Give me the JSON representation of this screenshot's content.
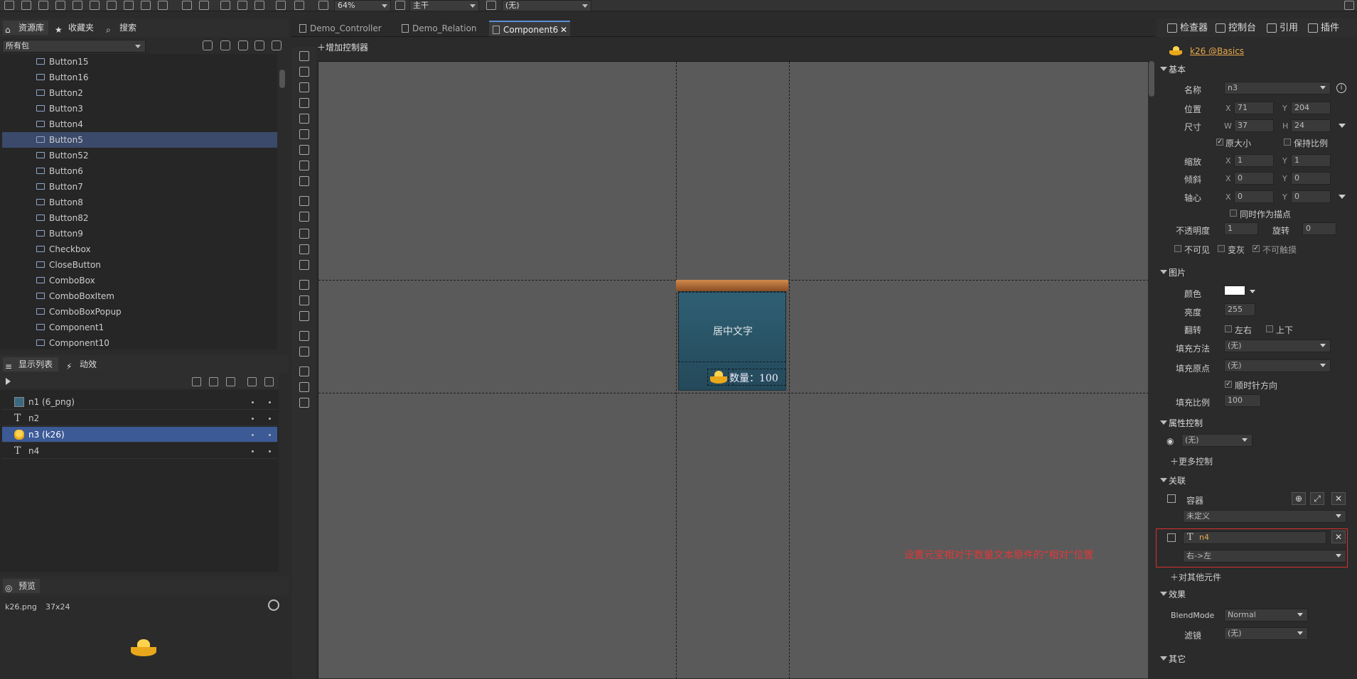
{
  "toolbar": {
    "zoom": "64%",
    "branch": "主干",
    "language": "(无)"
  },
  "library": {
    "tabs": [
      "资源库",
      "收藏夹",
      "搜索"
    ],
    "package_select": "所有包",
    "items": [
      "Button15",
      "Button16",
      "Button2",
      "Button3",
      "Button4",
      "Button5",
      "Button52",
      "Button6",
      "Button7",
      "Button8",
      "Button82",
      "Button9",
      "Checkbox",
      "CloseButton",
      "ComboBox",
      "ComboBoxItem",
      "ComboBoxPopup",
      "Component1",
      "Component10"
    ],
    "selected": "Button5"
  },
  "display_list": {
    "tabs": [
      "显示列表",
      "动效"
    ],
    "rows": [
      "n1 (6_png)",
      "n2",
      "n3 (k26)",
      "n4"
    ],
    "selected": "n3 (k26)"
  },
  "preview": {
    "tab": "预览",
    "file": "k26.png",
    "size": "37x24"
  },
  "editor": {
    "tabs": [
      "Demo_Controller",
      "Demo_Relation",
      "Component6"
    ],
    "active_tab": "Component6",
    "add_controller": "增加控制器",
    "center_text": "居中文字",
    "quantity_text": "数量：100",
    "annotation": "设置元宝相对于数量文本原件的“相对”位置"
  },
  "inspector": {
    "tabs": [
      "检查器",
      "控制台",
      "引用",
      "插件"
    ],
    "resource_link": "k26 @Basics",
    "basic": {
      "title": "基本",
      "name_label": "名称",
      "name": "n3",
      "pos_label": "位置",
      "x": "71",
      "y": "204",
      "size_label": "尺寸",
      "w": "37",
      "h": "24",
      "original_size": "原大小",
      "keep_ratio": "保持比例",
      "scale_label": "缩放",
      "scale_x": "1",
      "scale_y": "1",
      "skew_label": "倾斜",
      "skew_x": "0",
      "skew_y": "0",
      "pivot_label": "轴心",
      "pivot_x": "0",
      "pivot_y": "0",
      "as_anchor": "同时作为描点",
      "opacity_label": "不透明度",
      "opacity": "1",
      "rotation_label": "旋转",
      "rotation": "0",
      "invisible": "不可见",
      "gray": "变灰",
      "untouchable": "不可触摸"
    },
    "image": {
      "title": "图片",
      "color_label": "颜色",
      "color": "#ffffff",
      "brightness_label": "亮度",
      "brightness": "255",
      "flip_label": "翻转",
      "flip_h": "左右",
      "flip_v": "上下",
      "fill_method_label": "填充方法",
      "fill_method": "(无)",
      "fill_origin_label": "填充原点",
      "fill_origin": "(无)",
      "clockwise": "顺时针方向",
      "fill_amount_label": "填充比例",
      "fill_amount": "100"
    },
    "gear": {
      "title": "属性控制",
      "value": "(无)",
      "more": "更多控制"
    },
    "relations": {
      "title": "关联",
      "container": "容器",
      "container_value": "未定义",
      "target": "n4",
      "target_value": "右->左",
      "add_other": "对其他元件"
    },
    "effects": {
      "title": "效果",
      "blend_label": "BlendMode",
      "blend": "Normal",
      "filter_label": "滤镜",
      "filter": "(无)"
    },
    "other": {
      "title": "其它"
    }
  }
}
